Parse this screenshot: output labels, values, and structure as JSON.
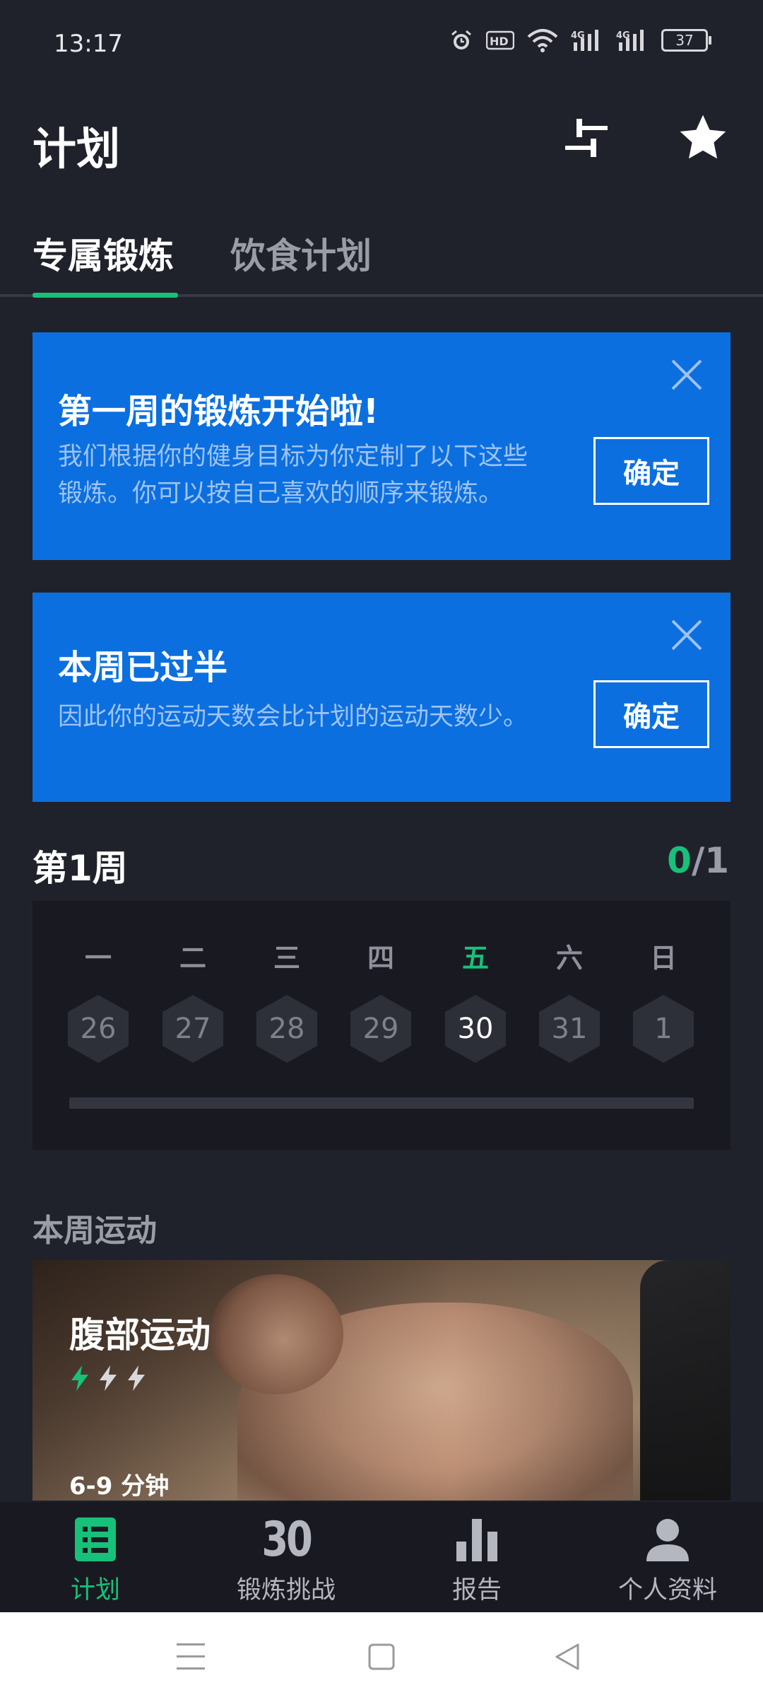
{
  "status_bar": {
    "time": "13:17",
    "battery": "37",
    "icons": [
      "alarm-icon",
      "hd-icon",
      "wifi-icon",
      "signal-4g-icon",
      "signal-4g-icon",
      "battery-icon"
    ]
  },
  "header": {
    "title": "计划"
  },
  "tabs": [
    {
      "label": "专属锻炼",
      "active": true
    },
    {
      "label": "饮食计划",
      "active": false
    }
  ],
  "banners": [
    {
      "title": "第一周的锻炼开始啦!",
      "text_line1": "我们根据你的健身目标为你定制了以下这些",
      "text_line2": "锻炼。你可以按自己喜欢的顺序来锻炼。",
      "button": "确定"
    },
    {
      "title": "本周已过半",
      "text_line1": "因此你的运动天数会比计划的运动天数少。",
      "button": "确定"
    }
  ],
  "week": {
    "title": "第1周",
    "progress_done": "0",
    "progress_total": "/1",
    "progress_fraction": 0.0,
    "days": [
      {
        "label": "一",
        "date": "26",
        "today": false
      },
      {
        "label": "二",
        "date": "27",
        "today": false
      },
      {
        "label": "三",
        "date": "28",
        "today": false
      },
      {
        "label": "四",
        "date": "29",
        "today": false
      },
      {
        "label": "五",
        "date": "30",
        "today": true
      },
      {
        "label": "六",
        "date": "31",
        "today": false
      },
      {
        "label": "日",
        "date": "1",
        "today": false
      }
    ]
  },
  "workouts_section": {
    "title": "本周运动",
    "items": [
      {
        "name": "腹部运动",
        "difficulty_level": 1,
        "difficulty_max": 3,
        "duration": "6-9 分钟"
      }
    ]
  },
  "bottom_nav": [
    {
      "label": "计划",
      "icon": "list-icon",
      "active": true
    },
    {
      "label": "锻炼挑战",
      "icon_text": "30",
      "active": false
    },
    {
      "label": "报告",
      "icon": "bar-chart-icon",
      "active": false
    },
    {
      "label": "个人资料",
      "icon": "person-icon",
      "active": false
    }
  ],
  "colors": {
    "background": "#20222b",
    "accent": "#17c17a",
    "banner": "#0b6fe0"
  }
}
